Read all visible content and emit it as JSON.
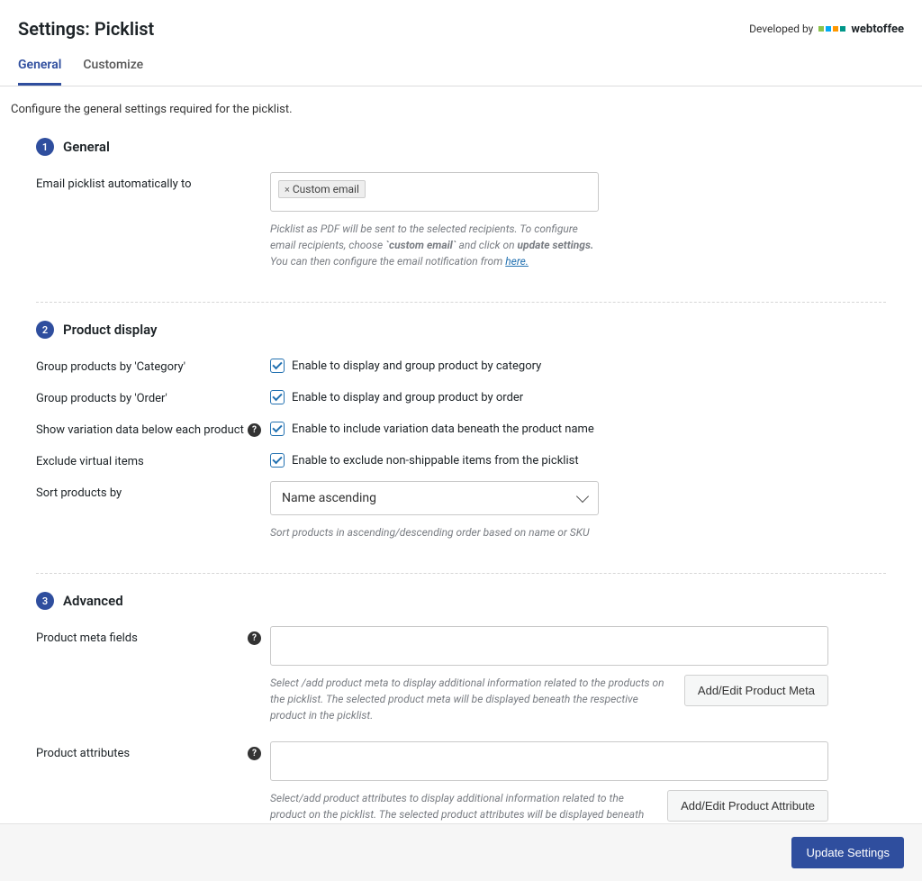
{
  "header": {
    "title": "Settings: Picklist",
    "developed_by": "Developed by",
    "brand": "webtoffee"
  },
  "tabs": [
    {
      "label": "General",
      "active": true
    },
    {
      "label": "Customize",
      "active": false
    }
  ],
  "intro": "Configure the general settings required for the picklist.",
  "sections": {
    "general": {
      "num": "1",
      "title": "General",
      "email_label": "Email picklist automatically to",
      "email_chip": "Custom email",
      "email_help_pre": "Picklist as PDF will be sent to the selected recipients. To configure email recipients, choose ",
      "email_help_code": "`custom email`",
      "email_help_mid": " and click on ",
      "email_help_bold": "update settings.",
      "email_help_post": " You can then configure the email notification from ",
      "email_help_link": "here."
    },
    "product_display": {
      "num": "2",
      "title": "Product display",
      "group_category_label": "Group products by 'Category'",
      "group_category_check": "Enable to display and group product by category",
      "group_order_label": "Group products by 'Order'",
      "group_order_check": "Enable to display and group product by order",
      "variation_label": "Show variation data below each product",
      "variation_check": "Enable to include variation data beneath the product name",
      "exclude_label": "Exclude virtual items",
      "exclude_check": "Enable to exclude non-shippable items from the picklist",
      "sort_label": "Sort products by",
      "sort_value": "Name ascending",
      "sort_help": "Sort products in ascending/descending order based on name or SKU"
    },
    "advanced": {
      "num": "3",
      "title": "Advanced",
      "meta_label": "Product meta fields",
      "meta_help": "Select /add product meta to display additional information related to the products on the picklist. The selected product meta will be displayed beneath the respective product in the picklist.",
      "meta_button": "Add/Edit Product Meta",
      "attr_label": "Product attributes",
      "attr_help": "Select/add product attributes to display additional information related to the product on the picklist. The selected product attributes will be displayed beneath the respective product in the picklist.",
      "attr_button": "Add/Edit Product Attribute"
    }
  },
  "footer": {
    "update": "Update Settings"
  }
}
